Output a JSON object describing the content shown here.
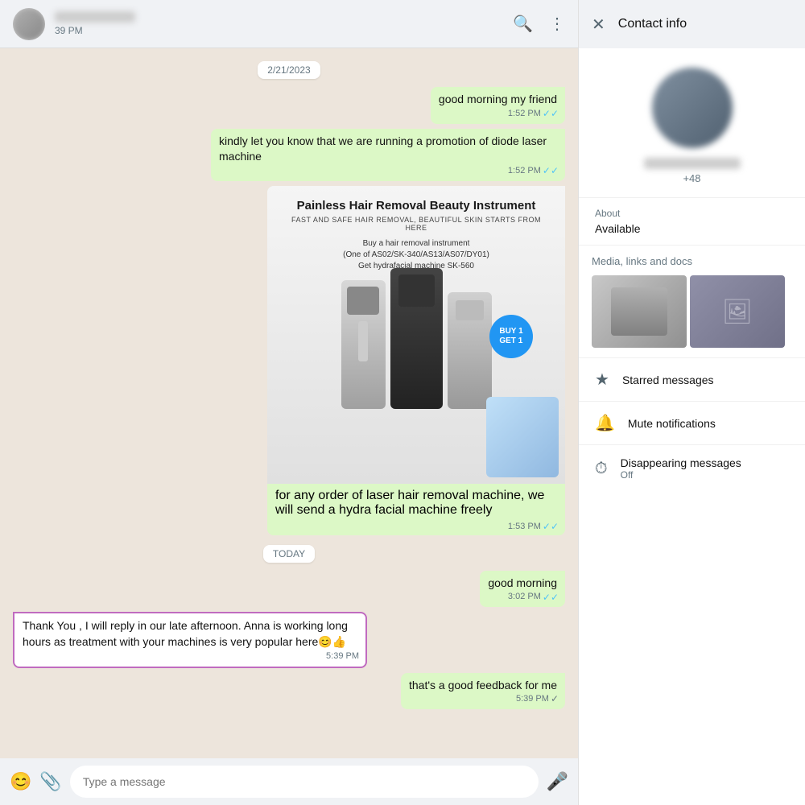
{
  "header": {
    "time": "39 PM",
    "search_icon": "🔍",
    "menu_icon": "⋮"
  },
  "chat": {
    "date_old": "2/21/2023",
    "date_today": "TODAY",
    "messages": [
      {
        "type": "out",
        "text": "good morning my friend",
        "time": "1:52 PM",
        "status": "read"
      },
      {
        "type": "out",
        "text": "kindly let you know that we are running a promotion of diode laser machine",
        "time": "1:52 PM",
        "status": "read"
      },
      {
        "type": "out-image",
        "caption": "for any order of laser hair removal machine, we will send a hydra facial machine freely",
        "time": "1:53 PM",
        "status": "read"
      },
      {
        "type": "out",
        "text": "good morning",
        "time": "3:02 PM",
        "status": "read"
      },
      {
        "type": "in",
        "text": "Thank You , I will reply in our late afternoon. Anna is working long hours as treatment with your machines is very popular here😊👍",
        "time": "5:39 PM",
        "highlighted": true
      },
      {
        "type": "out",
        "text": "that's a good feedback for me",
        "time": "5:39 PM",
        "status": "single"
      }
    ],
    "promo": {
      "title": "Painless Hair Removal Beauty Instrument",
      "subtitle": "FAST AND SAFE HAIR REMOVAL, BEAUTIFUL SKIN STARTS FROM HERE",
      "offer_line1": "Buy a hair removal instrument",
      "offer_line2": "(One of AS02/SK-340/AS13/AS07/DY01)",
      "offer_line3": "Get hydrafacial machine SK-560",
      "buy1get1": "BUY 1\nGET 1"
    },
    "input_placeholder": "Type a message"
  },
  "contact_info": {
    "title": "Contact info",
    "phone_number": "+48",
    "about_label": "About",
    "about_value": "Available",
    "media_label": "Media, links and docs",
    "starred_label": "Starred messages",
    "mute_label": "Mute notifications",
    "disappearing_label": "Disappearing messages",
    "disappearing_value": "Off"
  }
}
